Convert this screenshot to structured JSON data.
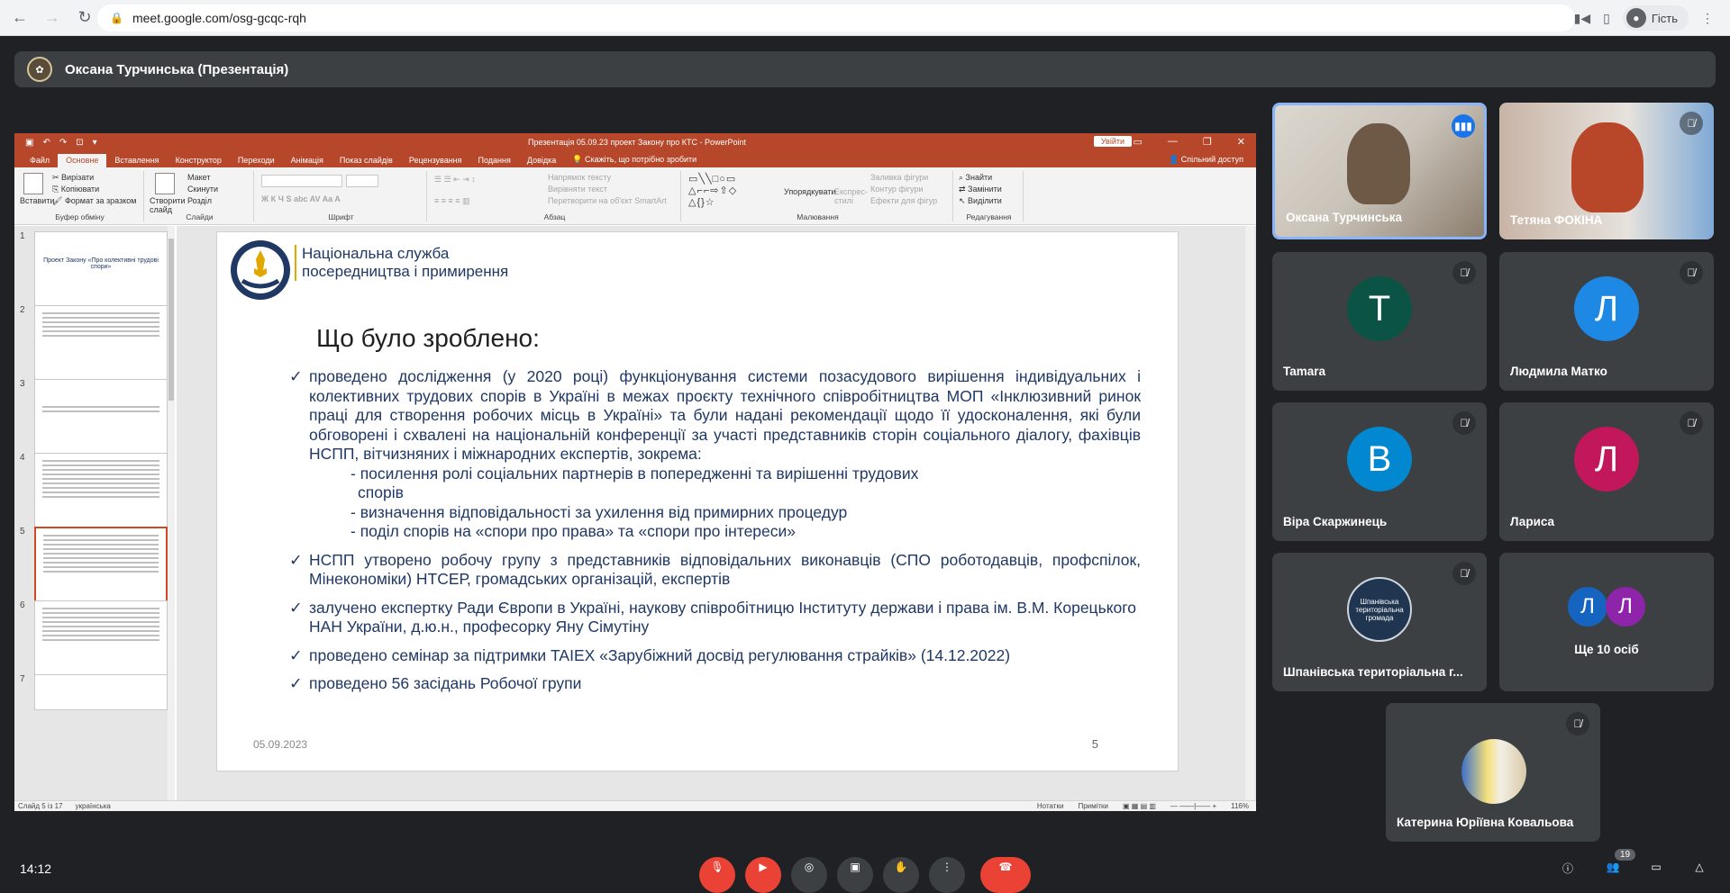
{
  "browser": {
    "url": "meet.google.com/osg-gcqc-rqh",
    "guest_label": "Гість"
  },
  "presenter_bar": {
    "name": "Оксана Турчинська (Презентація)"
  },
  "ppt": {
    "window_title": "Презентація 05.09.23 проект Закону про КТС  -  PowerPoint",
    "signin_label": "Увійти",
    "tabs": [
      "Файл",
      "Основне",
      "Вставлення",
      "Конструктор",
      "Переходи",
      "Анімація",
      "Показ слайдів",
      "Рецензування",
      "Подання",
      "Довідка"
    ],
    "tell_me": "Скажіть, що потрібно зробити",
    "share_label": "Спільний доступ",
    "ribbon": {
      "clipboard": {
        "name": "Буфер обміну",
        "paste": "Вставити",
        "cut": "Вирізати",
        "copy": "Копіювати",
        "format": "Формат за зразком"
      },
      "slides": {
        "name": "Слайди",
        "new_slide": "Створити слайд",
        "layout": "Макет",
        "reset": "Скинути",
        "section": "Розділ"
      },
      "font": {
        "name": "Шрифт"
      },
      "paragraph": {
        "name": "Абзац",
        "dir": "Напрямок тексту",
        "align": "Вирівняти текст",
        "smartart": "Перетворити на об'єкт SmartArt"
      },
      "drawing": {
        "name": "Малювання",
        "arrange": "Упорядкувати",
        "quick": "Експрес-стилі",
        "fill": "Заливка фігури",
        "outline": "Контур фігури",
        "effects": "Ефекти для фігур"
      },
      "editing": {
        "name": "Редагування",
        "find": "Знайти",
        "replace": "Замінити",
        "select": "Виділити"
      }
    },
    "thumb_numbers": [
      "1",
      "2",
      "3",
      "4",
      "5",
      "6",
      "7"
    ],
    "thumb1_title": "Проект Закону «Про колективні трудові спори»",
    "status_slide": "Слайд 5 із 17",
    "status_lang": "українська",
    "status_notes": "Нотатки",
    "status_comments": "Примітки",
    "zoom": "116%"
  },
  "slide": {
    "org_name": "Національна служба посередництва і примирення",
    "title": "Що було зроблено:",
    "bullet1": "проведено дослідження (у 2020 році) функціонування системи позасудового вирішення індивідуальних і колективних трудових спорів в Україні в межах проєкту технічного співробітництва МОП «Інклюзивний ринок праці для створення робочих місць в Україні» та були надані рекомендації щодо її удосконалення, які були обговорені і схвалені на національній конференції за участі представників сторін соціального діалогу, фахівців НСПП, вітчизняних і міжнародних експертів, зокрема:",
    "sub1": "- посилення ролі соціальних партнерів в попередженні та вирішенні трудових",
    "sub1b": "спорів",
    "sub2": "- визначення відповідальності за ухилення від примирних процедур",
    "sub3": "- поділ спорів на «спори про права» та «спори про інтереси»",
    "bullet2": "НСПП утворено робочу групу з представників відповідальних виконавців (СПО роботодавців, профспілок, Мінекономіки) НТСЕР, громадських організацій, експертів",
    "bullet3": "залучено експертку Ради Європи в Україні, наукову співробітницю Інституту держави і права ім. В.М. Корецького НАН України, д.ю.н., професорку Яну Сімутіну",
    "bullet4": "проведено семінар за підтримки TAIEX «Зарубіжний досвід регулювання страйків» (14.12.2022)",
    "bullet5": "проведено 56 засідань Робочої групи",
    "date": "05.09.2023",
    "number": "5"
  },
  "participants": [
    {
      "name": "Оксана Турчинська",
      "type": "video"
    },
    {
      "name": "Тетяна ФОКІНА",
      "type": "video"
    },
    {
      "name": "Tamara",
      "initial": "T",
      "color": "#0b5345"
    },
    {
      "name": "Людмила Матко",
      "initial": "Л",
      "color": "#1e88e5"
    },
    {
      "name": "Віра Скаржинець",
      "initial": "В",
      "color": "#0288d1"
    },
    {
      "name": "Лариса",
      "initial": "Л",
      "color": "#c2185b"
    },
    {
      "name": "Шпанівська територіальна г...",
      "logo_text": "Шпанівська територіальна громада"
    },
    {
      "name": "Ще 10 осіб",
      "initials": [
        "Л",
        "Л"
      ]
    },
    {
      "name": "Катерина Юріївна Ковальова",
      "type": "photo"
    }
  ],
  "bottom": {
    "time": "14:12",
    "people_count": "19"
  }
}
